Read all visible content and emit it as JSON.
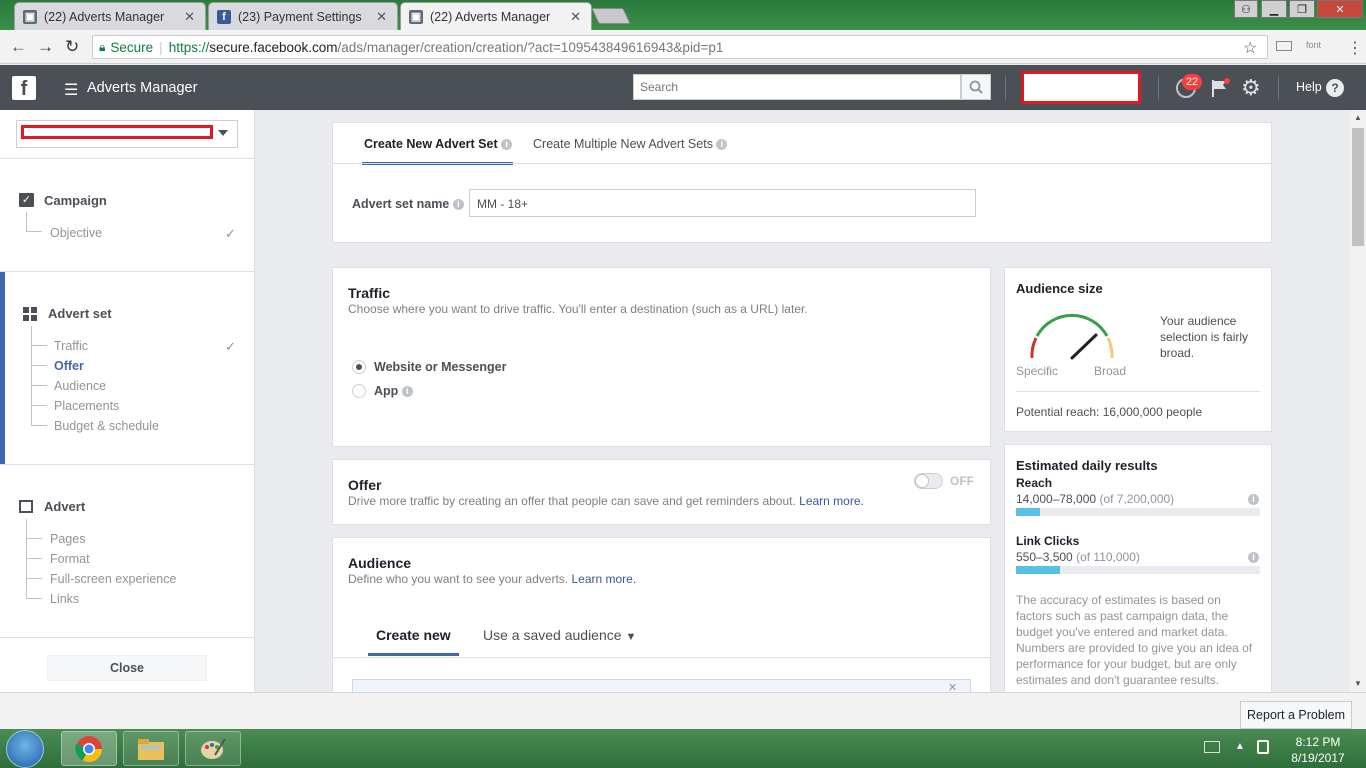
{
  "browser": {
    "tabs": [
      {
        "title": "(22) Adverts Manager",
        "favicon": "adverts-manager-icon"
      },
      {
        "title": "(23) Payment Settings",
        "favicon": "facebook-icon"
      },
      {
        "title": "(22) Adverts Manager",
        "favicon": "adverts-manager-icon"
      }
    ],
    "secure_label": "Secure",
    "url_scheme": "https://",
    "url_host": "secure.facebook.com",
    "url_path": "/ads/manager/creation/creation/?act=109543849616943&pid=p1",
    "ext_label": "font"
  },
  "header": {
    "app_title": "Adverts Manager",
    "search_placeholder": "Search",
    "notif_count": "22",
    "help_label": "Help",
    "help_glyph": "?"
  },
  "sidebar": {
    "campaign": {
      "title": "Campaign",
      "items": [
        "Objective"
      ]
    },
    "advert_set": {
      "title": "Advert set",
      "items": [
        "Traffic",
        "Offer",
        "Audience",
        "Placements",
        "Budget & schedule"
      ]
    },
    "advert": {
      "title": "Advert",
      "items": [
        "Pages",
        "Format",
        "Full-screen experience",
        "Links"
      ]
    },
    "close_label": "Close"
  },
  "top_panel": {
    "tab1": "Create New Advert Set",
    "tab2": "Create Multiple New Advert Sets",
    "name_label": "Advert set name",
    "name_value": "MM - 18+"
  },
  "traffic": {
    "title": "Traffic",
    "desc": "Choose where you want to drive traffic. You'll enter a destination (such as a URL) later.",
    "option1": "Website or Messenger",
    "option2": "App"
  },
  "offer": {
    "title": "Offer",
    "desc": "Drive more traffic by creating an offer that people can save and get reminders about.",
    "learn_more": "Learn more.",
    "toggle_state": "OFF"
  },
  "audience": {
    "title": "Audience",
    "desc": "Define who you want to see your adverts.",
    "learn_more": "Learn more.",
    "tab_create": "Create new",
    "tab_saved": "Use a saved audience"
  },
  "audience_size": {
    "title": "Audience size",
    "description": "Your audience selection is fairly broad.",
    "label_specific": "Specific",
    "label_broad": "Broad",
    "potential_reach": "Potential reach: 16,000,000 people"
  },
  "estimates": {
    "title": "Estimated daily results",
    "reach_label": "Reach",
    "reach_value": "14,000–78,000",
    "reach_of": "(of 7,200,000)",
    "reach_fraction": 0.1,
    "clicks_label": "Link Clicks",
    "clicks_value": "550–3,500",
    "clicks_of": "(of 110,000)",
    "clicks_fraction": 0.18,
    "note": "The accuracy of estimates is based on factors such as past campaign data, the budget you've entered and market data. Numbers are provided to give you an idea of performance for your budget, but are only estimates and don't guarantee results."
  },
  "footer": {
    "report_label": "Report a Problem"
  },
  "taskbar": {
    "time": "8:12 PM",
    "date": "8/19/2017"
  },
  "colors": {
    "fb_header": "#4b4f56",
    "link": "#365899",
    "accent": "#4267b2",
    "redaction": "#e01a22",
    "meter_fill": "#5ac1e6"
  }
}
